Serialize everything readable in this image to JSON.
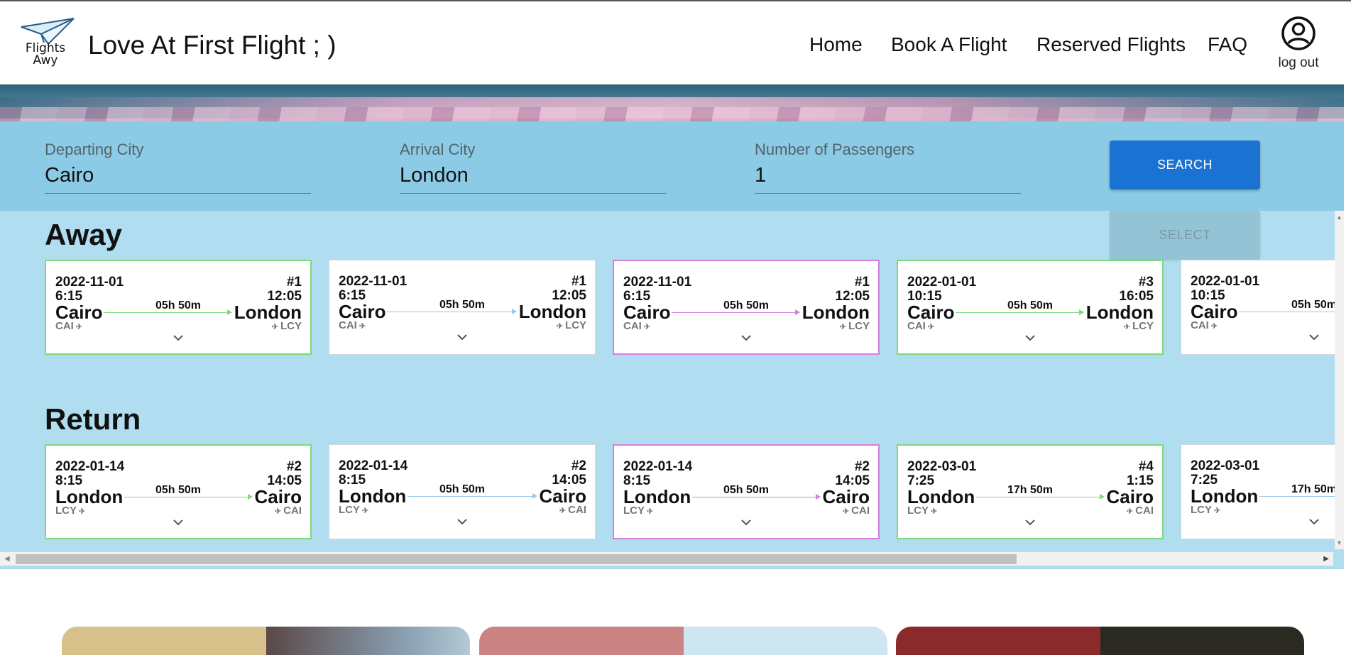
{
  "header": {
    "logo_text_line1": "Flights",
    "logo_text_line2": "Awy",
    "title": "Love At First Flight ; )",
    "nav": [
      "Home",
      "Book A Flight",
      "Reserved Flights",
      "FAQ"
    ],
    "account_label": "log out"
  },
  "search": {
    "departing_label": "Departing City",
    "departing_value": "Cairo",
    "arrival_label": "Arrival City",
    "arrival_value": "London",
    "passengers_label": "Number of Passengers",
    "passengers_value": "1",
    "search_button": "SEARCH"
  },
  "away": {
    "title": "Away",
    "select_button": "SELECT",
    "cards": [
      {
        "date": "2022-11-01",
        "depart_time": "6:15",
        "number": "#1",
        "arrive_time": "12:05",
        "from": "Cairo",
        "to": "London",
        "from_code": "CAI",
        "to_code": "LCY",
        "duration": "05h 50m",
        "style": "green"
      },
      {
        "date": "2022-11-01",
        "depart_time": "6:15",
        "number": "#1",
        "arrive_time": "12:05",
        "from": "Cairo",
        "to": "London",
        "from_code": "CAI",
        "to_code": "LCY",
        "duration": "05h 50m",
        "style": "plain"
      },
      {
        "date": "2022-11-01",
        "depart_time": "6:15",
        "number": "#1",
        "arrive_time": "12:05",
        "from": "Cairo",
        "to": "London",
        "from_code": "CAI",
        "to_code": "LCY",
        "duration": "05h 50m",
        "style": "pink"
      },
      {
        "date": "2022-01-01",
        "depart_time": "10:15",
        "number": "#3",
        "arrive_time": "16:05",
        "from": "Cairo",
        "to": "London",
        "from_code": "CAI",
        "to_code": "LCY",
        "duration": "05h 50m",
        "style": "green"
      },
      {
        "date": "2022-01-01",
        "depart_time": "10:15",
        "number": "",
        "arrive_time": "",
        "from": "Cairo",
        "to": "",
        "from_code": "CAI",
        "to_code": "",
        "duration": "05h 50m",
        "style": "plain"
      }
    ]
  },
  "return": {
    "title": "Return",
    "cards": [
      {
        "date": "2022-01-14",
        "depart_time": "8:15",
        "number": "#2",
        "arrive_time": "14:05",
        "from": "London",
        "to": "Cairo",
        "from_code": "LCY",
        "to_code": "CAI",
        "duration": "05h 50m",
        "style": "green"
      },
      {
        "date": "2022-01-14",
        "depart_time": "8:15",
        "number": "#2",
        "arrive_time": "14:05",
        "from": "London",
        "to": "Cairo",
        "from_code": "LCY",
        "to_code": "CAI",
        "duration": "05h 50m",
        "style": "plain"
      },
      {
        "date": "2022-01-14",
        "depart_time": "8:15",
        "number": "#2",
        "arrive_time": "14:05",
        "from": "London",
        "to": "Cairo",
        "from_code": "LCY",
        "to_code": "CAI",
        "duration": "05h 50m",
        "style": "pink"
      },
      {
        "date": "2022-03-01",
        "depart_time": "7:25",
        "number": "#4",
        "arrive_time": "1:15",
        "from": "London",
        "to": "Cairo",
        "from_code": "LCY",
        "to_code": "CAI",
        "duration": "17h 50m",
        "style": "green"
      },
      {
        "date": "2022-03-01",
        "depart_time": "7:25",
        "number": "",
        "arrive_time": "",
        "from": "London",
        "to": "",
        "from_code": "LCY",
        "to_code": "",
        "duration": "17h 50m",
        "style": "plain"
      }
    ]
  },
  "colors": {
    "primary_button": "#1a73d2",
    "results_bg": "#b0def0",
    "search_bg": "#8ccbe6",
    "card_green": "#7cd97c",
    "card_pink": "#d27fe0",
    "line_blue": "#9cc8e8"
  },
  "icons": {
    "logo": "paper-plane-logo",
    "account": "account-circle-icon",
    "takeoff": "airplane-takeoff-icon",
    "landing": "airplane-landing-icon",
    "expand": "chevron-down-icon"
  }
}
